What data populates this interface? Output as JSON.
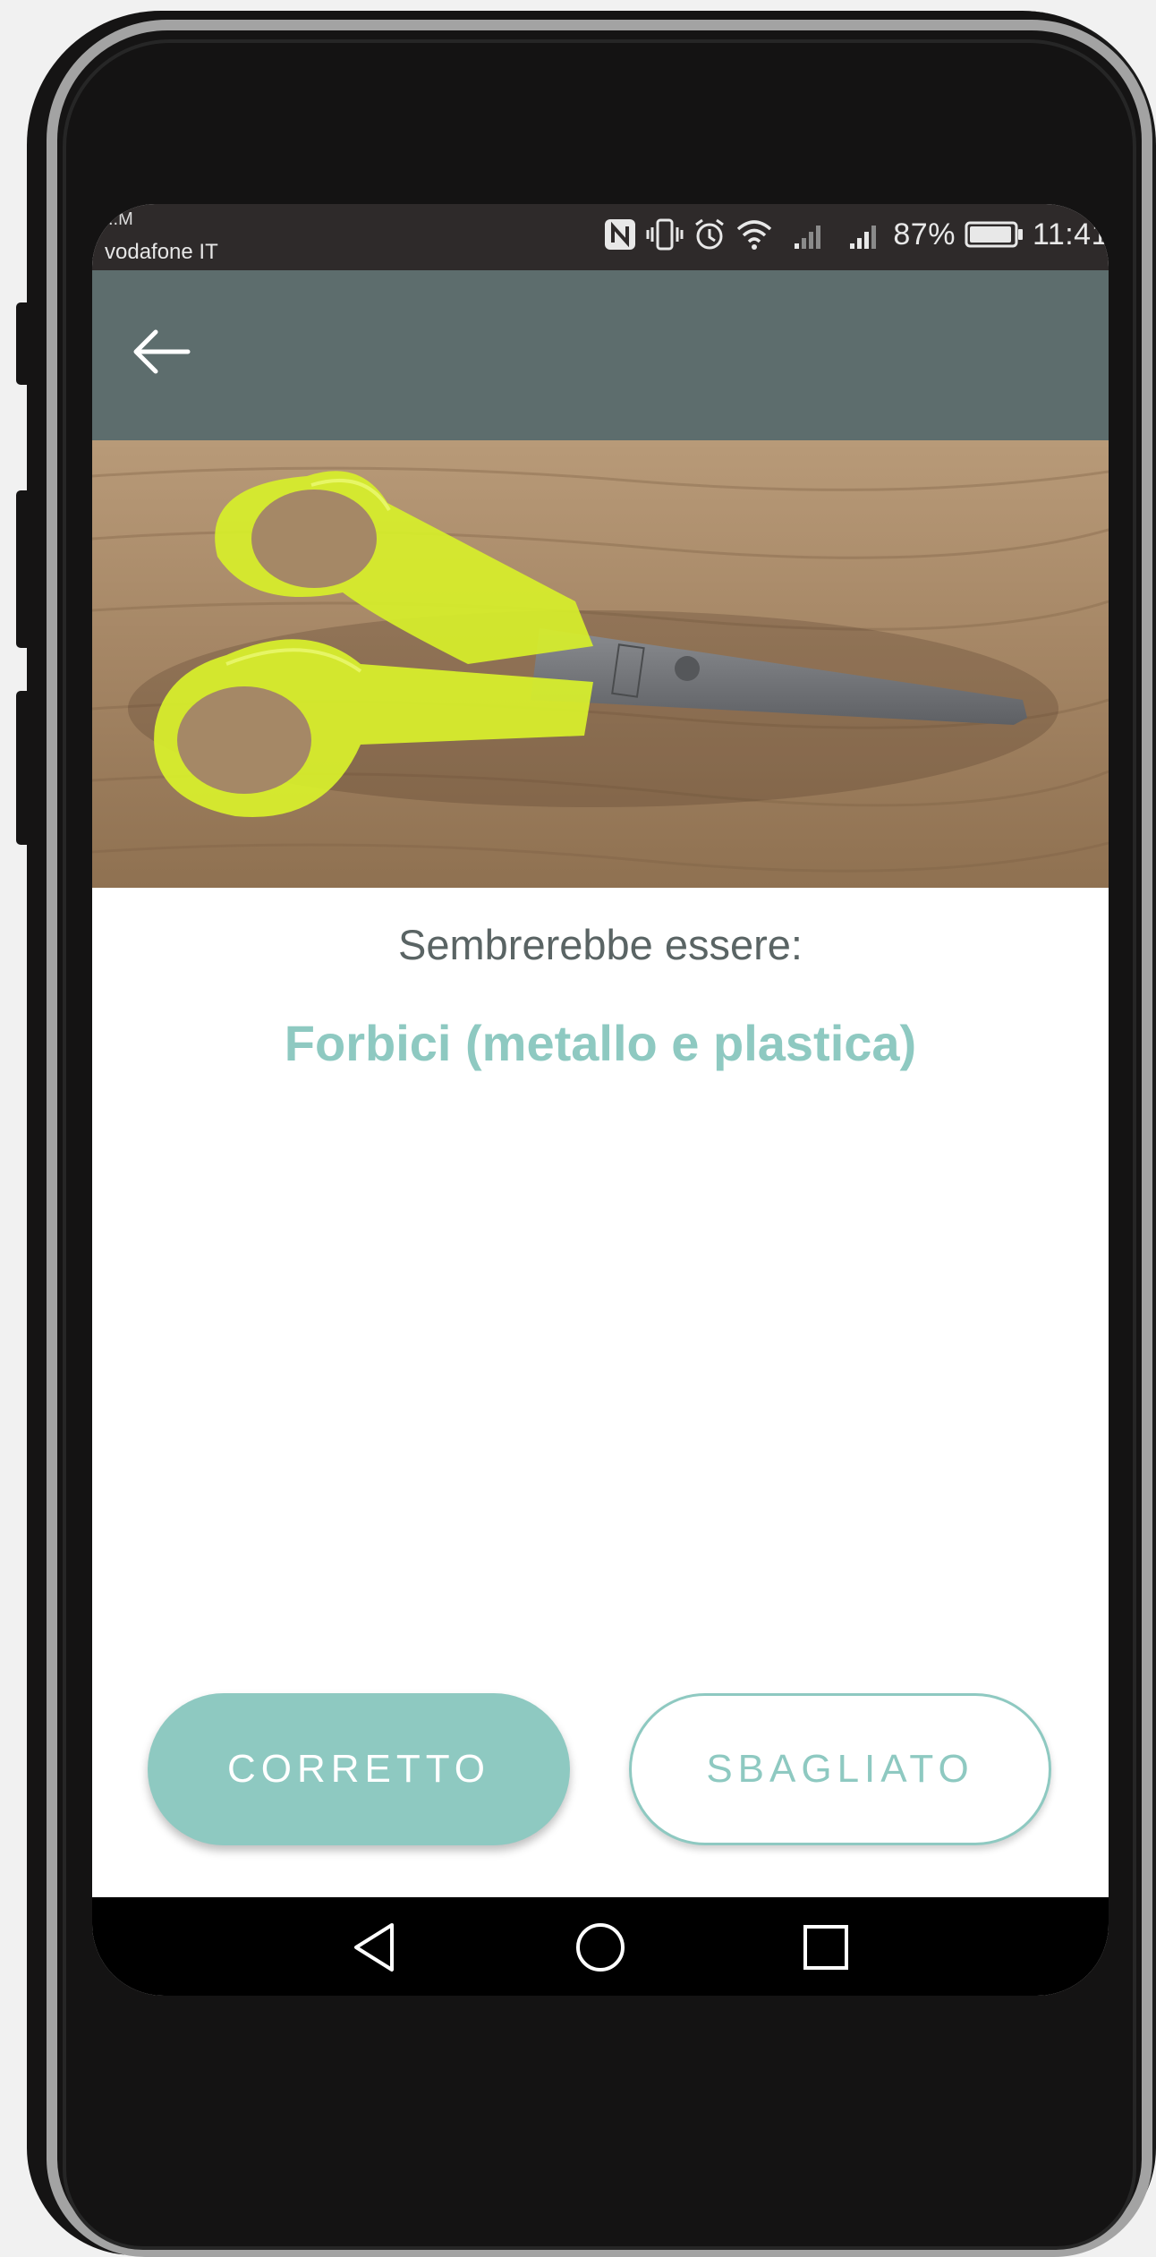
{
  "status_bar": {
    "carrier_top": "..M",
    "carrier": "vodafone IT",
    "battery_percent": "87%",
    "time": "11:41",
    "icons": [
      "nfc-icon",
      "vibrate-icon",
      "alarm-icon",
      "wifi-icon",
      "signal-icon",
      "signal-icon",
      "battery-icon"
    ]
  },
  "app_bar": {
    "back_icon": "arrow-left-icon"
  },
  "photo": {
    "subject": "scissors-photo"
  },
  "result": {
    "prompt": "Sembrerebbe essere:",
    "label": "Forbici (metallo e plastica)"
  },
  "actions": {
    "correct_label": "CORRETTO",
    "wrong_label": "SBAGLIATO"
  },
  "nav_bar": {
    "icons": [
      "back-triangle-icon",
      "home-circle-icon",
      "recents-square-icon"
    ]
  },
  "colors": {
    "accent": "#8ec9c1",
    "app_bar": "#5d6d6d",
    "status_bar": "#2e2a2a",
    "prompt_text": "#5a6464"
  }
}
